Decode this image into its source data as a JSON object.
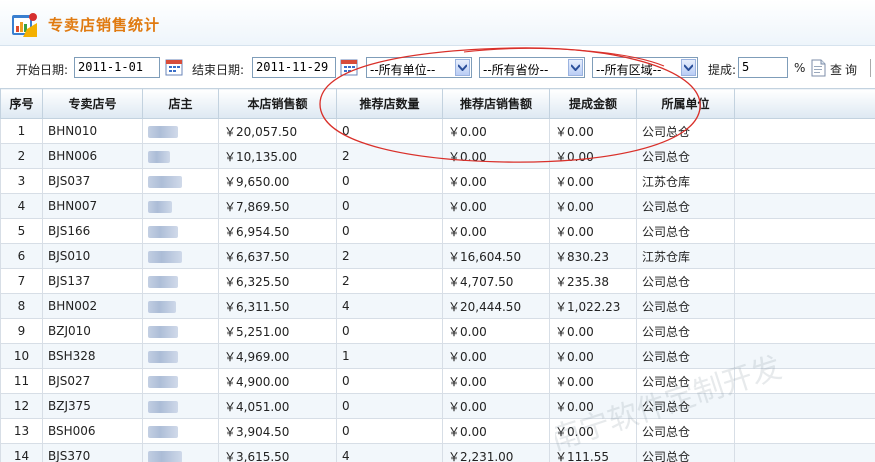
{
  "title": "专卖店销售统计",
  "filters": {
    "start_label": "开始日期:",
    "start_value": "2011-1-01",
    "end_label": "结束日期:",
    "end_value": "2011-11-29",
    "unit_select": "--所有单位--",
    "province_select": "--所有省份--",
    "region_select": "--所有区域--",
    "commission_label": "提成:",
    "commission_value": "5",
    "percent": "%",
    "query_label": "查询"
  },
  "columns": [
    "序号",
    "专卖店号",
    "店主",
    "本店销售额",
    "推荐店数量",
    "推荐店销售额",
    "提成金额",
    "所属单位"
  ],
  "rows": [
    {
      "idx": "1",
      "store": "BHN010",
      "sales": "￥20,057.50",
      "count": "0",
      "ref_sales": "￥0.00",
      "commission": "￥0.00",
      "unit": "公司总仓"
    },
    {
      "idx": "2",
      "store": "BHN006",
      "sales": "￥10,135.00",
      "count": "2",
      "ref_sales": "￥0.00",
      "commission": "￥0.00",
      "unit": "公司总仓"
    },
    {
      "idx": "3",
      "store": "BJS037",
      "sales": "￥9,650.00",
      "count": "0",
      "ref_sales": "￥0.00",
      "commission": "￥0.00",
      "unit": "江苏仓库"
    },
    {
      "idx": "4",
      "store": "BHN007",
      "sales": "￥7,869.50",
      "count": "0",
      "ref_sales": "￥0.00",
      "commission": "￥0.00",
      "unit": "公司总仓"
    },
    {
      "idx": "5",
      "store": "BJS166",
      "sales": "￥6,954.50",
      "count": "0",
      "ref_sales": "￥0.00",
      "commission": "￥0.00",
      "unit": "公司总仓"
    },
    {
      "idx": "6",
      "store": "BJS010",
      "sales": "￥6,637.50",
      "count": "2",
      "ref_sales": "￥16,604.50",
      "commission": "￥830.23",
      "unit": "江苏仓库"
    },
    {
      "idx": "7",
      "store": "BJS137",
      "sales": "￥6,325.50",
      "count": "2",
      "ref_sales": "￥4,707.50",
      "commission": "￥235.38",
      "unit": "公司总仓"
    },
    {
      "idx": "8",
      "store": "BHN002",
      "sales": "￥6,311.50",
      "count": "4",
      "ref_sales": "￥20,444.50",
      "commission": "￥1,022.23",
      "unit": "公司总仓"
    },
    {
      "idx": "9",
      "store": "BZJ010",
      "sales": "￥5,251.00",
      "count": "0",
      "ref_sales": "￥0.00",
      "commission": "￥0.00",
      "unit": "公司总仓"
    },
    {
      "idx": "10",
      "store": "BSH328",
      "sales": "￥4,969.00",
      "count": "1",
      "ref_sales": "￥0.00",
      "commission": "￥0.00",
      "unit": "公司总仓"
    },
    {
      "idx": "11",
      "store": "BJS027",
      "sales": "￥4,900.00",
      "count": "0",
      "ref_sales": "￥0.00",
      "commission": "￥0.00",
      "unit": "公司总仓"
    },
    {
      "idx": "12",
      "store": "BZJ375",
      "sales": "￥4,051.00",
      "count": "0",
      "ref_sales": "￥0.00",
      "commission": "￥0.00",
      "unit": "公司总仓"
    },
    {
      "idx": "13",
      "store": "BSH006",
      "sales": "￥3,904.50",
      "count": "0",
      "ref_sales": "￥0.00",
      "commission": "￥0.00",
      "unit": "公司总仓"
    },
    {
      "idx": "14",
      "store": "BJS370",
      "sales": "￥3,615.50",
      "count": "4",
      "ref_sales": "￥2,231.00",
      "commission": "￥111.55",
      "unit": "公司总仓"
    }
  ],
  "watermark": "南宁软件定制开发",
  "colors": {
    "title": "#e07a10",
    "annotation": "#d9302a",
    "header_bg": "#dde8f2",
    "alt_row": "#f2f7fb"
  },
  "icons": {
    "title": "chart-folder-icon",
    "calendar": "calendar-icon",
    "dropdown": "chevron-down-icon",
    "query": "document-search-icon"
  }
}
